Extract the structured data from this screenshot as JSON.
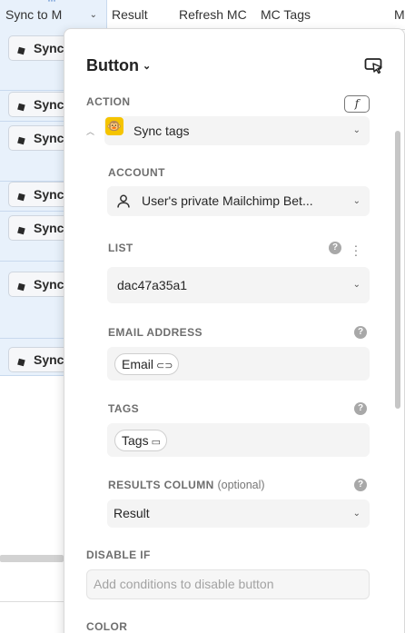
{
  "grid": {
    "columns": [
      {
        "label": "Sync to M"
      },
      {
        "label": "Result"
      },
      {
        "label": "Refresh MC"
      },
      {
        "label": "MC Tags"
      },
      {
        "label": "M"
      }
    ],
    "first_col_dots": "···",
    "sync_rows": [
      {
        "label": "Sync"
      },
      {
        "label": "Sync"
      },
      {
        "label": "Sync"
      },
      {
        "label": "Sync"
      },
      {
        "label": "Sync"
      },
      {
        "label": "Sync"
      },
      {
        "label": "Sync"
      }
    ]
  },
  "panel": {
    "title": "Button",
    "action": {
      "label": "ACTION",
      "fx": "f",
      "value": "Sync tags"
    },
    "account": {
      "label": "ACCOUNT",
      "value": "User's private Mailchimp Bet..."
    },
    "list": {
      "label": "LIST",
      "value": "dac47a35a1"
    },
    "email": {
      "label": "EMAIL ADDRESS",
      "chip": "Email"
    },
    "tags": {
      "label": "TAGS",
      "chip": "Tags"
    },
    "results": {
      "label": "RESULTS COLUMN",
      "optional": "(optional)",
      "value": "Result"
    },
    "disable_if": {
      "label": "DISABLE IF",
      "placeholder": "Add conditions to disable button"
    },
    "color": {
      "label": "COLOR"
    }
  },
  "icons": {
    "help": "?",
    "caret": "⌄",
    "tag": "🏷",
    "link": "⛓",
    "brand_color": "#f5c400"
  }
}
